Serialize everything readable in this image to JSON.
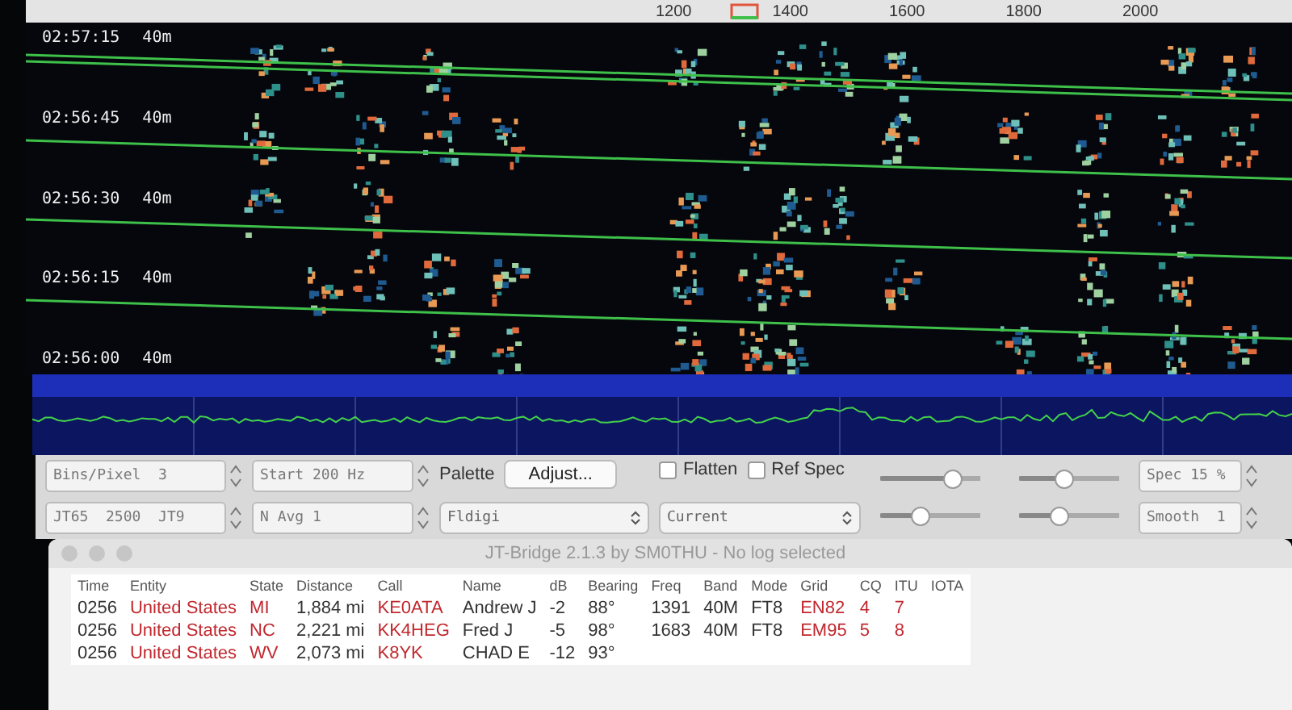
{
  "ruler": {
    "labels": [
      "1200",
      "1400",
      "1600",
      "1800",
      "2000"
    ]
  },
  "waterfall": {
    "rows": [
      {
        "time": "02:57:15",
        "band": "40m"
      },
      {
        "time": "02:56:45",
        "band": "40m"
      },
      {
        "time": "02:56:30",
        "band": "40m"
      },
      {
        "time": "02:56:15",
        "band": "40m"
      },
      {
        "time": "02:56:00",
        "band": "40m"
      }
    ]
  },
  "controls": {
    "bins": "Bins/Pixel  3",
    "start": "Start 200 Hz",
    "mode": "JT65  2500  JT9",
    "navg": "N Avg 1",
    "palette_label": "Palette",
    "adjust_button": "Adjust...",
    "palette": "Fldigi",
    "checkboxes": [
      {
        "label": "Flatten",
        "checked": false
      },
      {
        "label": "Ref Spec",
        "checked": false
      }
    ],
    "spectrum_select": "Current",
    "sliders": [
      {
        "level": 0.72
      },
      {
        "level": 0.45
      },
      {
        "level": 0.4
      },
      {
        "level": 0.4
      }
    ],
    "spec": "Spec 15 %",
    "smooth": "Smooth  1"
  },
  "window": {
    "title": "JT-Bridge 2.1.3 by SM0THU - No log selected",
    "columns": [
      {
        "label": "Time",
        "highlight": false
      },
      {
        "label": "Entity",
        "highlight": true
      },
      {
        "label": "State",
        "highlight": true
      },
      {
        "label": "Distance",
        "highlight": false
      },
      {
        "label": "Call",
        "highlight": true
      },
      {
        "label": "Name",
        "highlight": false
      },
      {
        "label": "dB",
        "highlight": false
      },
      {
        "label": "Bearing",
        "highlight": false
      },
      {
        "label": "Freq",
        "highlight": false
      },
      {
        "label": "Band",
        "highlight": false
      },
      {
        "label": "Mode",
        "highlight": false
      },
      {
        "label": "Grid",
        "highlight": true
      },
      {
        "label": "CQ",
        "highlight": true
      },
      {
        "label": "ITU",
        "highlight": true
      },
      {
        "label": "IOTA"
      }
    ],
    "rows": [
      [
        "0256",
        "United States",
        "MI",
        "1,884 mi",
        "KE0ATA",
        "Andrew J",
        "-2",
        "88°",
        "1391",
        "40M",
        "FT8",
        "EN82",
        "4",
        "7"
      ],
      [
        "0256",
        "United States",
        "NC",
        "2,221 mi",
        "KK4HEG",
        "Fred J",
        "-5",
        "98°",
        "1683",
        "40M",
        "FT8",
        "EM95",
        "5",
        "8"
      ],
      [
        "0256",
        "United States",
        "WV",
        "2,073 mi",
        "K8YK",
        "CHAD E",
        "-12",
        "93°"
      ]
    ]
  }
}
